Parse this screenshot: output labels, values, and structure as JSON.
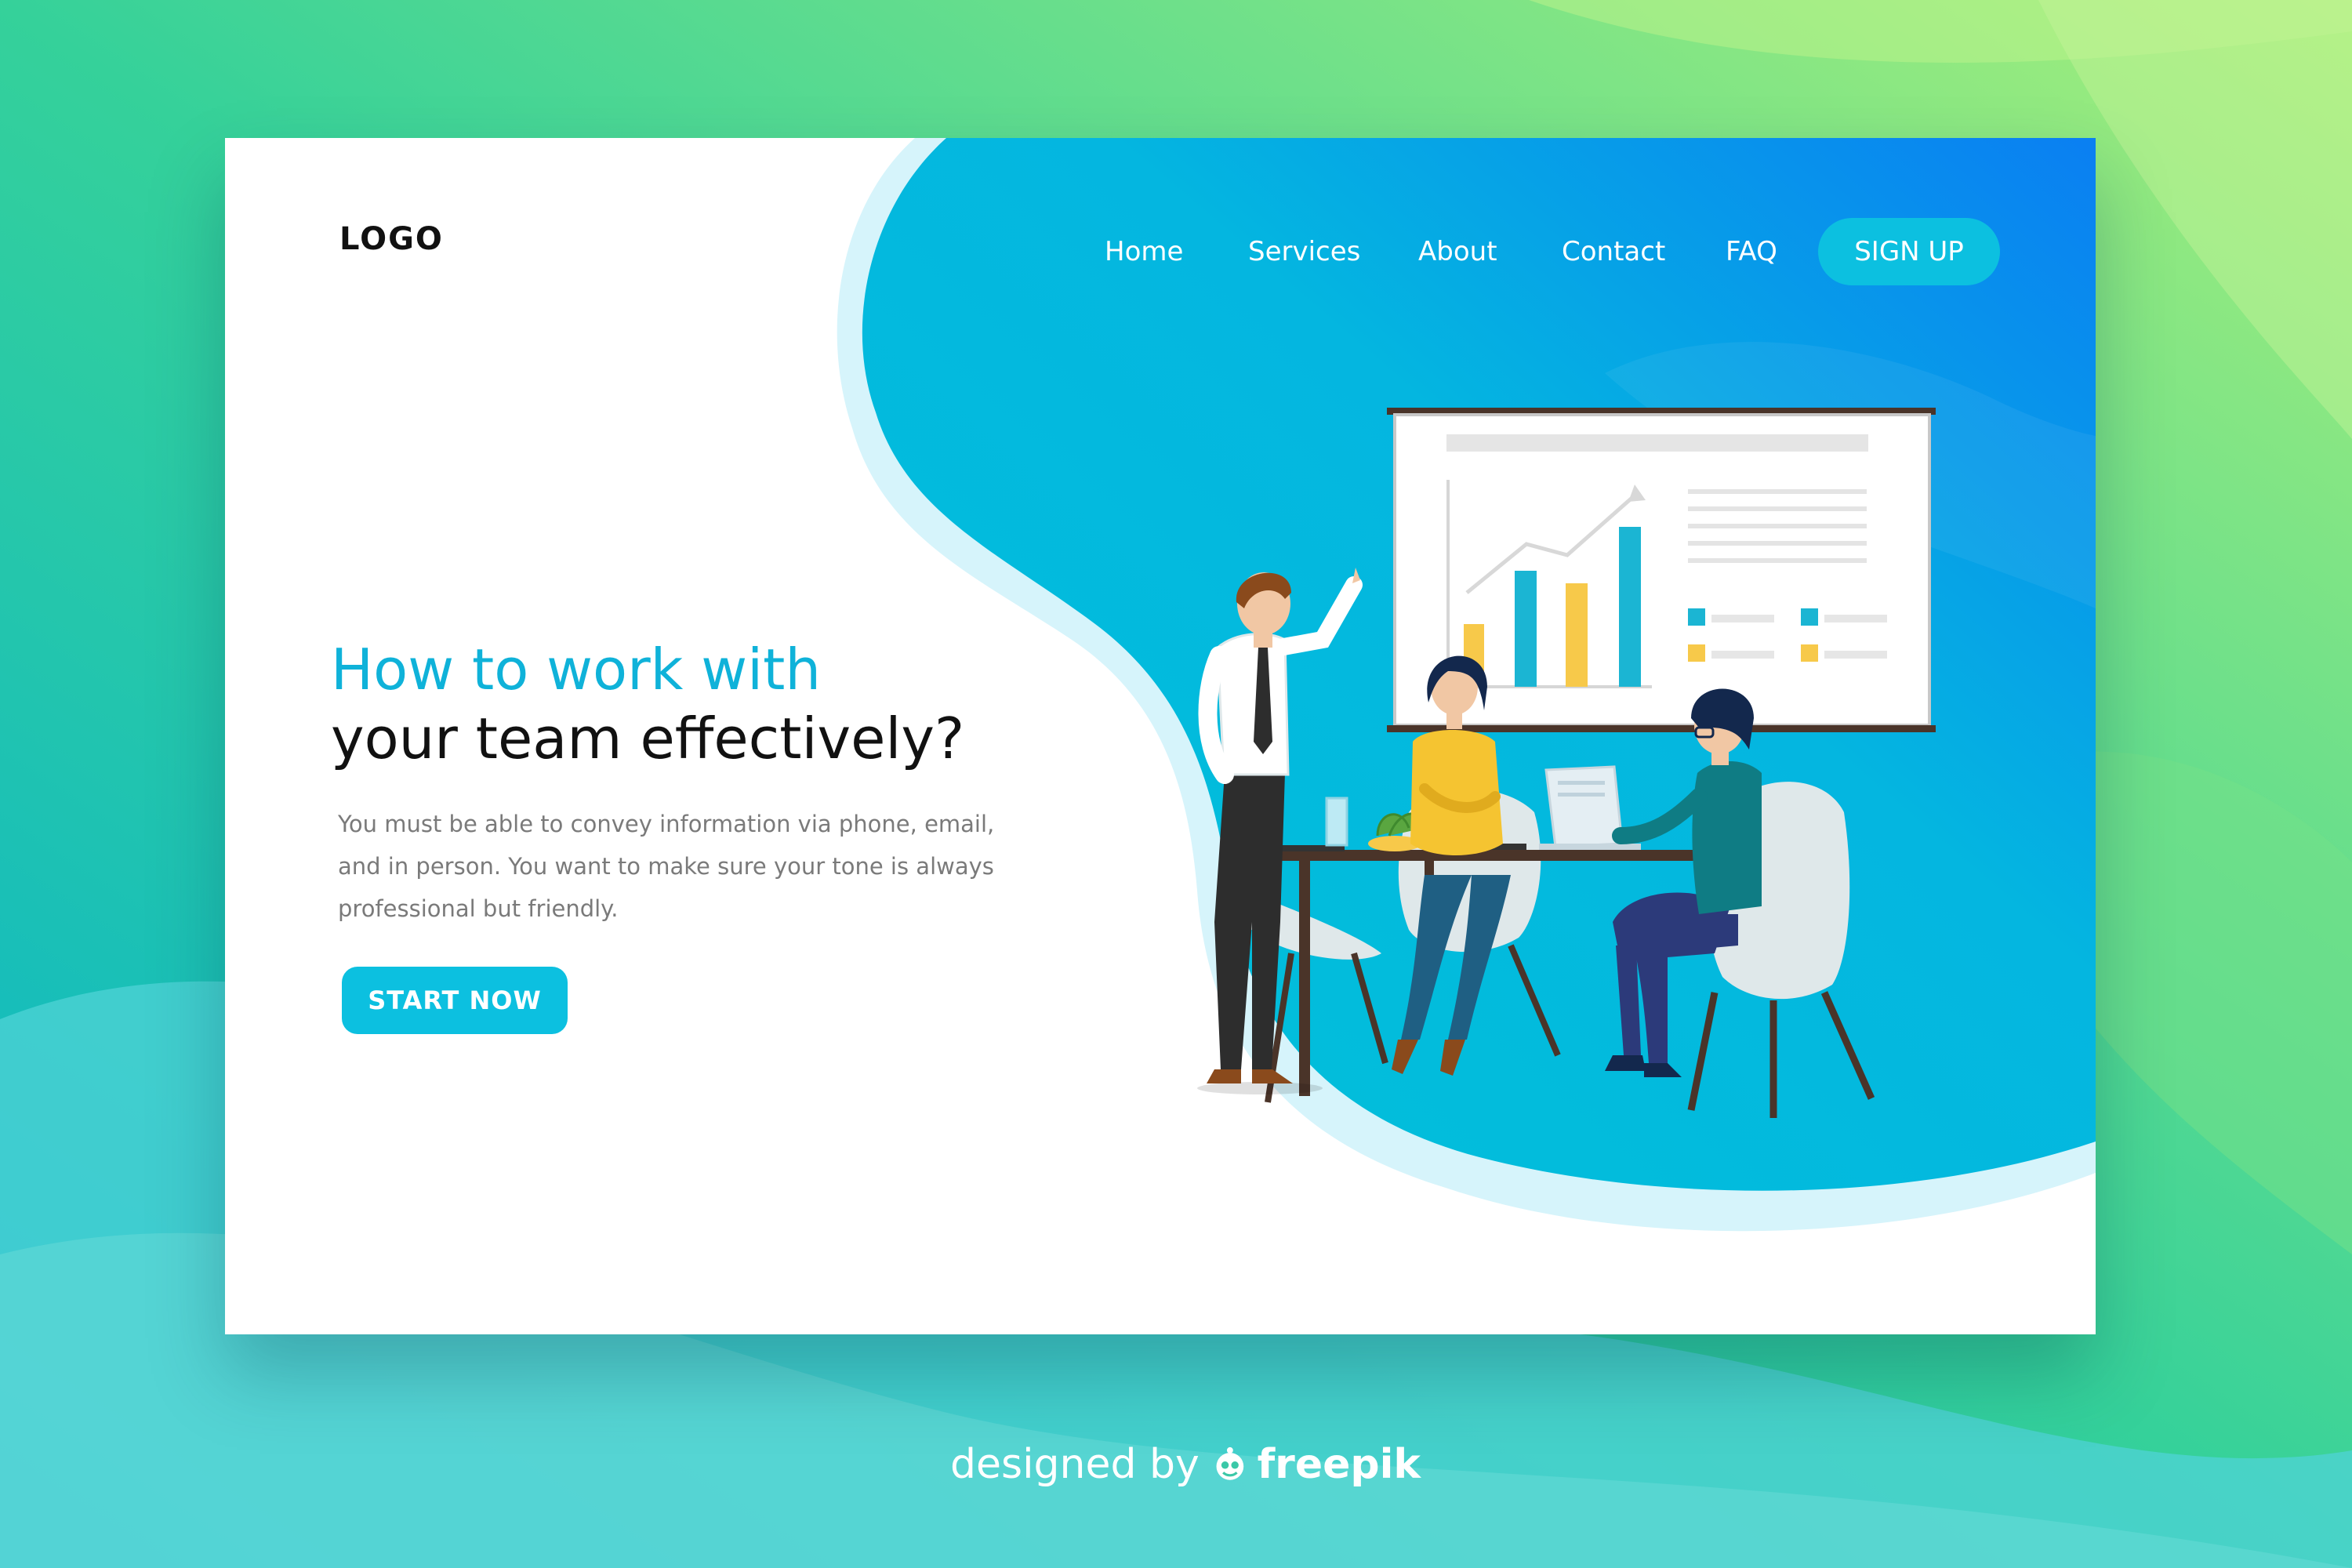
{
  "header": {
    "logo": "LOGO",
    "nav": [
      "Home",
      "Services",
      "About",
      "Contact",
      "FAQ"
    ],
    "signup": "SIGN UP"
  },
  "hero": {
    "title_line1": "How to work with",
    "title_line2": "your team effectively?",
    "description": "You must be able to convey information via phone, email, and in person. You want to make sure your tone is always professional but friendly.",
    "cta": "START NOW"
  },
  "footer": {
    "designed_by": "designed by",
    "brand": "freepik"
  },
  "colors": {
    "accent": "#0cc0e0",
    "title_blue": "#0fb2d9",
    "background_green": "#6fe07a",
    "background_teal": "#00b8cc",
    "blob_blue": "#0a80f0"
  },
  "icons": [
    "freepik-logo-icon"
  ]
}
